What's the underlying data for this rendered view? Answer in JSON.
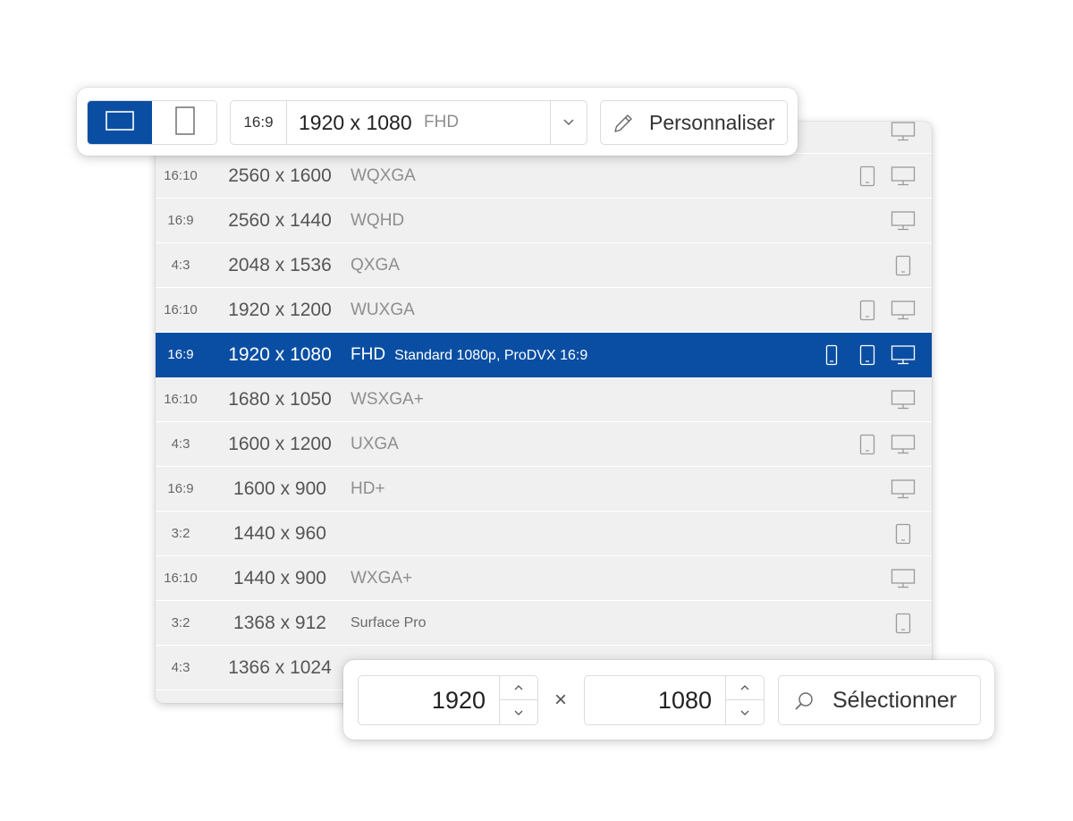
{
  "toolbar": {
    "orientation_landscape_icon": "landscape-icon",
    "orientation_portrait_icon": "portrait-icon",
    "selected_preset": {
      "ratio": "16:9",
      "resolution": "1920 x 1080",
      "name": "FHD"
    },
    "dropdown_icon": "chevron-down-icon",
    "customize_label": "Personnaliser",
    "customize_icon": "pencil-icon"
  },
  "presets": [
    {
      "ratio": "",
      "resolution": "",
      "name": "",
      "devices": [
        "monitor"
      ]
    },
    {
      "ratio": "16:10",
      "resolution": "2560 x 1600",
      "name": "WQXGA",
      "devices": [
        "tablet",
        "monitor"
      ]
    },
    {
      "ratio": "16:9",
      "resolution": "2560 x 1440",
      "name": "WQHD",
      "devices": [
        "monitor"
      ]
    },
    {
      "ratio": "4:3",
      "resolution": "2048 x 1536",
      "name": "QXGA",
      "devices": [
        "tablet"
      ]
    },
    {
      "ratio": "16:10",
      "resolution": "1920 x 1200",
      "name": "WUXGA",
      "devices": [
        "tablet",
        "monitor"
      ]
    },
    {
      "ratio": "16:9",
      "resolution": "1920 x 1080",
      "name": "FHD",
      "desc": "Standard 1080p, ProDVX 16:9",
      "selected": true,
      "devices": [
        "phone",
        "tablet",
        "monitor"
      ]
    },
    {
      "ratio": "16:10",
      "resolution": "1680 x 1050",
      "name": "WSXGA+",
      "devices": [
        "monitor"
      ]
    },
    {
      "ratio": "4:3",
      "resolution": "1600 x 1200",
      "name": "UXGA",
      "devices": [
        "tablet",
        "monitor"
      ]
    },
    {
      "ratio": "16:9",
      "resolution": "1600 x 900",
      "name": "HD+",
      "devices": [
        "monitor"
      ]
    },
    {
      "ratio": "3:2",
      "resolution": "1440 x 960",
      "name": "",
      "devices": [
        "tablet"
      ]
    },
    {
      "ratio": "16:10",
      "resolution": "1440 x 900",
      "name": "WXGA+",
      "devices": [
        "monitor"
      ]
    },
    {
      "ratio": "3:2",
      "resolution": "1368 x 912",
      "name": "Surface Pro",
      "name_small": true,
      "devices": [
        "tablet"
      ]
    },
    {
      "ratio": "4:3",
      "resolution": "1366 x 1024",
      "name": "",
      "devices": []
    }
  ],
  "size_input": {
    "width": "1920",
    "height": "1080",
    "separator": "×",
    "spinner_up_icon": "chevron-up-icon",
    "spinner_down_icon": "chevron-down-icon",
    "select_label": "Sélectionner",
    "select_icon": "search-icon"
  },
  "colors": {
    "accent": "#0a4ea3",
    "list_background": "#f0f0f0",
    "icon_gray": "#9a9a9a"
  }
}
